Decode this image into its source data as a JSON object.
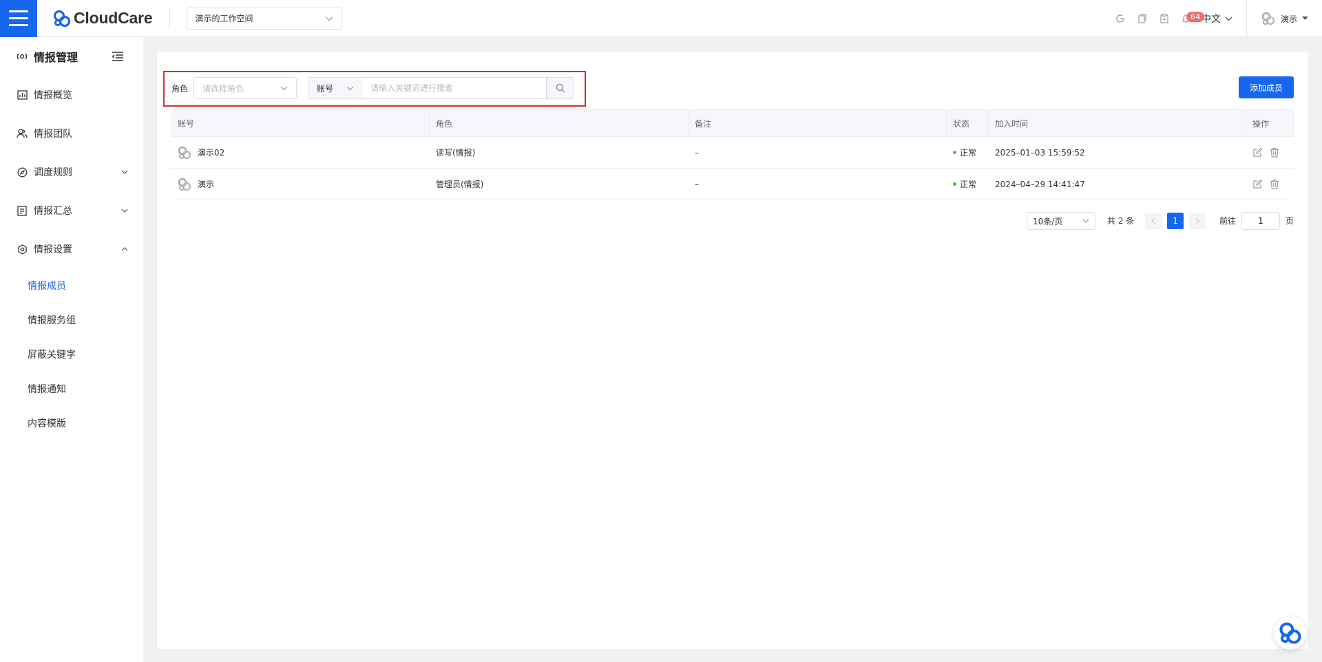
{
  "header": {
    "logo_text": "CloudCare",
    "workspace": "演示的工作空间",
    "notification_count": "64",
    "language": "中文",
    "user_name": "演示"
  },
  "sidebar": {
    "title": "情报管理",
    "items": [
      {
        "label": "情报概览",
        "icon": "chart-box-icon"
      },
      {
        "label": "情报团队",
        "icon": "team-icon"
      },
      {
        "label": "调度规则",
        "icon": "compass-icon"
      },
      {
        "label": "情报汇总",
        "icon": "document-icon"
      },
      {
        "label": "情报设置",
        "icon": "settings-icon"
      }
    ],
    "subitems": [
      "情报成员",
      "情报服务组",
      "屏蔽关键字",
      "情报通知",
      "内容模版"
    ],
    "active_subitem": "情报成员"
  },
  "filter": {
    "role_label": "角色",
    "role_placeholder": "请选择角色",
    "field_select": "账号",
    "keyword_placeholder": "请输入关键词进行搜索",
    "add_button": "添加成员"
  },
  "table": {
    "headers": [
      "账号",
      "角色",
      "备注",
      "状态",
      "加入时间",
      "操作"
    ],
    "rows": [
      {
        "account": "演示02",
        "role": "读写(情报)",
        "note": "–",
        "status": "正常",
        "joined": "2025–01–03 15:59:52"
      },
      {
        "account": "演示",
        "role": "管理员(情报)",
        "note": "–",
        "status": "正常",
        "joined": "2024–04–29 14:41:47"
      }
    ]
  },
  "pagination": {
    "page_size": "10条/页",
    "total": "共 2 条",
    "current_page": "1",
    "goto_label": "前往",
    "goto_value": "1",
    "page_unit": "页"
  },
  "colors": {
    "primary": "#1766f0",
    "highlight": "#e02a2a",
    "status_ok": "#3ec93e",
    "badge": "#f56c6c"
  }
}
